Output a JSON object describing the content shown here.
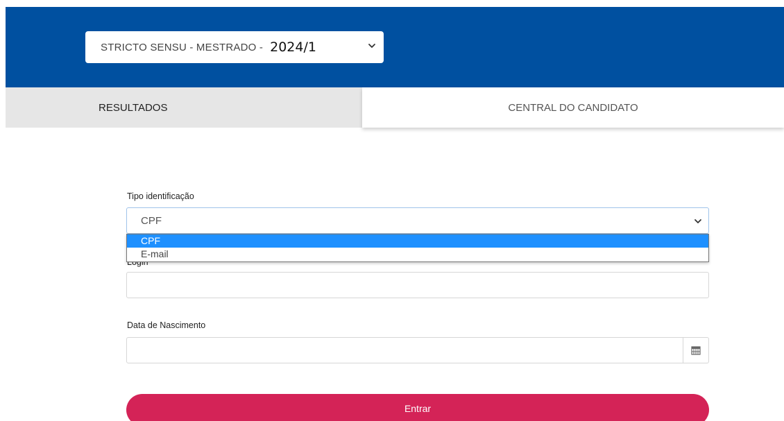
{
  "header": {
    "period_prefix": "STRICTO SENSU - MESTRADO -",
    "period_year": "2024/1",
    "color": "#0050a0"
  },
  "tabs": [
    {
      "label": "RESULTADOS",
      "active": false
    },
    {
      "label": "CENTRAL DO CANDIDATO",
      "active": true
    }
  ],
  "form": {
    "id_type_label": "Tipo identificação",
    "id_type_value": "CPF",
    "id_type_options": [
      {
        "label": "CPF",
        "selected": true
      },
      {
        "label": "E-mail",
        "selected": false
      }
    ],
    "login_label": "Login",
    "login_value": "",
    "birth_label": "Data de Nascimento",
    "birth_value": "",
    "calendar_icon": "calendar-icon",
    "submit_label": "Entrar",
    "submit_color": "#d42357"
  }
}
